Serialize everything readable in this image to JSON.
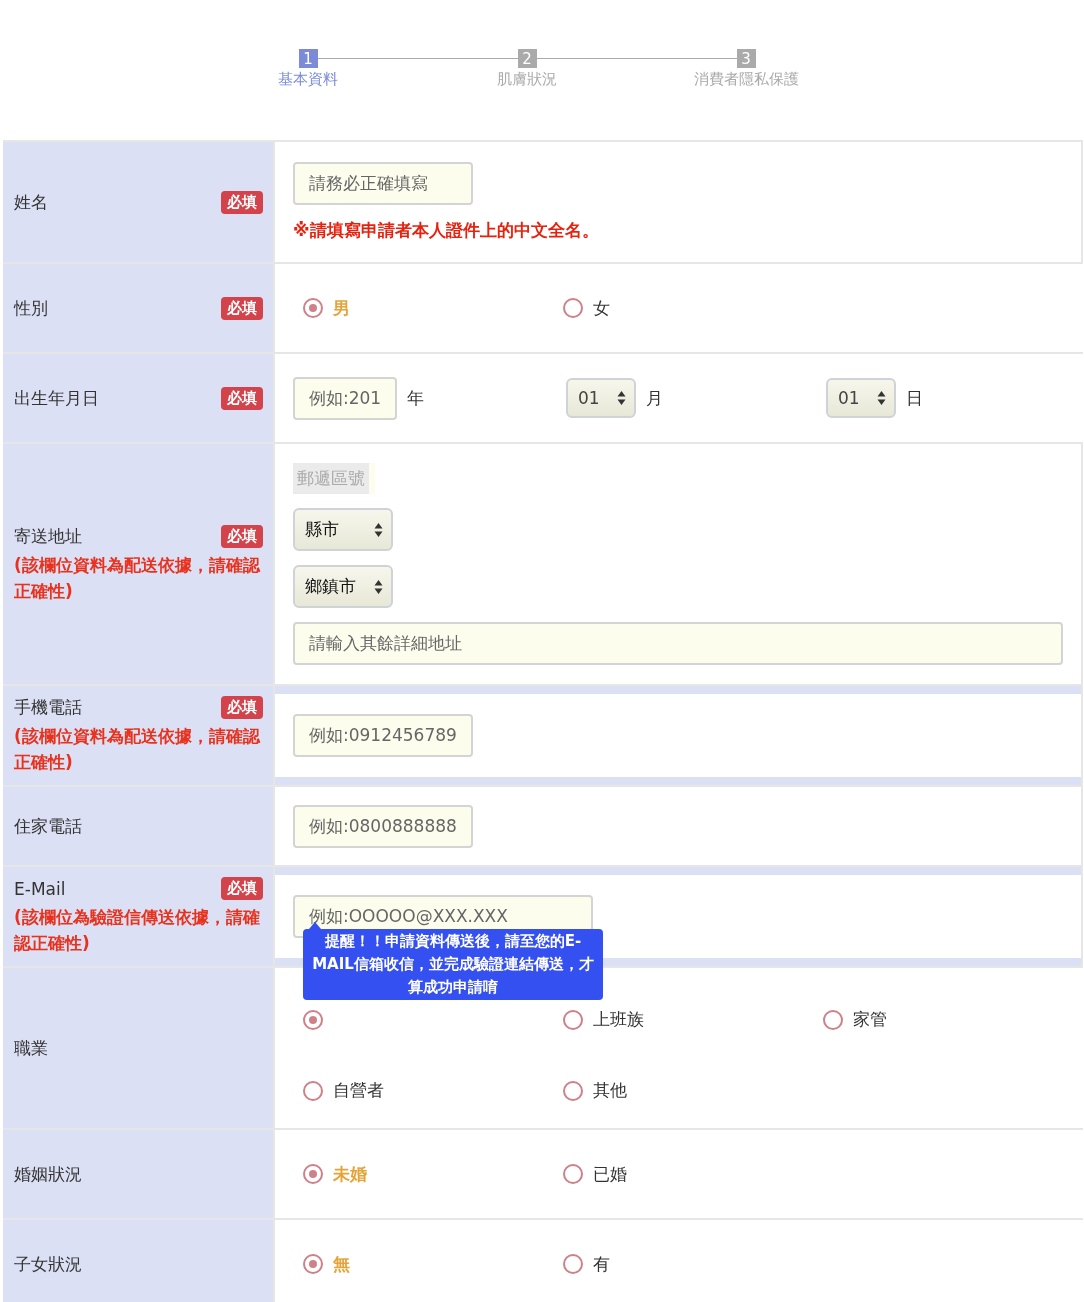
{
  "steps": [
    {
      "number": "1",
      "label": "基本資料",
      "selected": true
    },
    {
      "number": "2",
      "label": "肌膚狀況",
      "selected": false
    },
    {
      "number": "3",
      "label": "消費者隱私保護",
      "selected": false
    }
  ],
  "rows": [
    {
      "kind": "text",
      "label": "姓名",
      "badge": "必填",
      "field": {
        "placeholder": "請務必正確填寫"
      },
      "hint": "※請填寫申請者本人證件上的中文全名。"
    },
    {
      "kind": "radio",
      "label": "性別",
      "badge": "必填",
      "options": [
        {
          "label": "男",
          "selected": true
        },
        {
          "label": "女",
          "selected": false
        }
      ]
    },
    {
      "kind": "birth",
      "label": "出生年月日",
      "badge": "必填",
      "year": {
        "placeholder": "例如:201",
        "unit": "年"
      },
      "month": {
        "value": "01",
        "unit": "月"
      },
      "day": {
        "value": "01",
        "unit": "日"
      }
    },
    {
      "kind": "address",
      "label": "寄送地址",
      "badge": "必填",
      "note": "(該欄位資料為配送依據，請確認正確性)",
      "postal": {
        "placeholder": "郵遞區號"
      },
      "city": {
        "value": "縣市"
      },
      "district": {
        "value": "鄉鎮市"
      },
      "detail": {
        "placeholder": "請輸入其餘詳細地址"
      }
    },
    {
      "kind": "text",
      "label": "手機電話",
      "badge": "必填",
      "note": "(該欄位資料為配送依據，請確認正確性)",
      "field": {
        "placeholder": "例如:0912456789"
      }
    },
    {
      "kind": "text",
      "label": "住家電話",
      "field": {
        "placeholder": "例如:0800888888"
      }
    },
    {
      "kind": "text",
      "label": "E-Mail",
      "badge": "必填",
      "note": "(該欄位為驗證信傳送依據，請確認正確性)",
      "field": {
        "placeholder": "例如:OOOOO@XXX.XXX"
      },
      "tooltip": "提醒！！申請資料傳送後，請至您的E-MAIL信箱收信，並完成驗證連結傳送，才算成功申請唷"
    },
    {
      "kind": "radio",
      "label": "職業",
      "options": [
        {
          "selected": true
        },
        {
          "label": "上班族",
          "selected": false
        },
        {
          "label": "家管",
          "selected": false
        },
        {
          "label": "自營者",
          "selected": false
        },
        {
          "label": "其他",
          "selected": false
        }
      ]
    },
    {
      "kind": "radio",
      "label": "婚姻狀況",
      "options": [
        {
          "label": "未婚",
          "selected": true
        },
        {
          "label": "已婚",
          "selected": false
        }
      ]
    },
    {
      "kind": "radio",
      "label": "子女狀況",
      "options": [
        {
          "label": "無",
          "selected": true
        },
        {
          "label": "有",
          "selected": false
        }
      ]
    }
  ]
}
